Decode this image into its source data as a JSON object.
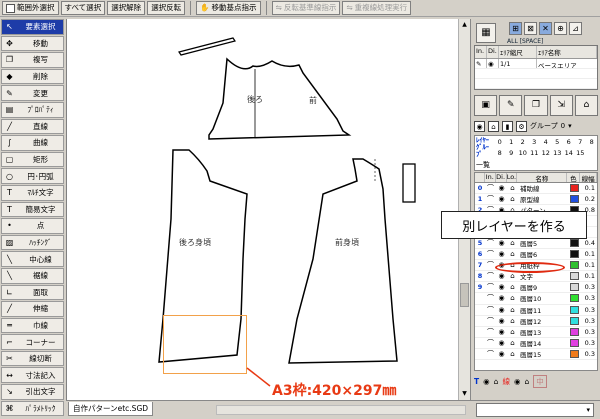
{
  "toolbar": {
    "buttons": [
      {
        "label": "範囲外選択",
        "checkbox": true
      },
      {
        "label": "すべて選択"
      },
      {
        "label": "選択解除"
      },
      {
        "label": "選択反転"
      },
      {
        "label": "移動基点指示"
      },
      {
        "label": "反転基準線指示",
        "disabled": true
      },
      {
        "label": "重複線処理実行",
        "disabled": true
      }
    ]
  },
  "left_tools": [
    {
      "icon": "↖",
      "label": "要素選択",
      "selected": true
    },
    {
      "icon": "✥",
      "label": "移動"
    },
    {
      "icon": "❐",
      "label": "複写"
    },
    {
      "icon": "◆",
      "label": "削除"
    },
    {
      "icon": "✎",
      "label": "変更"
    },
    {
      "icon": "▤",
      "label": "ﾌﾟﾛﾊﾟﾃｨ"
    },
    {
      "icon": "╱",
      "label": "直線"
    },
    {
      "icon": "∫",
      "label": "曲線"
    },
    {
      "icon": "▢",
      "label": "矩形"
    },
    {
      "icon": "○",
      "label": "円･円弧"
    },
    {
      "icon": "T",
      "label": "ﾏﾙﾁ文字"
    },
    {
      "icon": "T",
      "label": "簡易文字"
    },
    {
      "icon": "•",
      "label": "点"
    },
    {
      "icon": "▨",
      "label": "ﾊｯﾁﾝｸﾞ"
    },
    {
      "icon": "╲",
      "label": "中心線"
    },
    {
      "icon": "╲",
      "label": "裾線"
    },
    {
      "icon": "∟",
      "label": "面取"
    },
    {
      "icon": "╱",
      "label": "伸縮"
    },
    {
      "icon": "═",
      "label": "巾線"
    },
    {
      "icon": "⌐",
      "label": "コーナー"
    },
    {
      "icon": "✂",
      "label": "線切断"
    },
    {
      "icon": "↔",
      "label": "寸法記入"
    },
    {
      "icon": "↘",
      "label": "引出文字"
    },
    {
      "icon": "⌘",
      "label": "ﾊﾟﾗﾒﾄﾘｯｸ"
    }
  ],
  "canvas": {
    "labels": {
      "back": "後ろ",
      "front": "前",
      "back_body": "後ろ身頃",
      "front_body": "前身頃"
    }
  },
  "tab": {
    "file": "自作パターンetc.SGD"
  },
  "right_panel": {
    "allspace": "ALL [SPACE]",
    "area_headers": [
      "In.",
      "Di.",
      "ｴﾘｱ縮尺",
      "ｴﾘｱ名称"
    ],
    "area_row": {
      "scale": "1/1",
      "name": "ベースエリア"
    },
    "group_label": "グループ",
    "group_value": "0",
    "layer_group_label": "ﾚｲﾔｰ ｸﾞﾙｰﾌﾟ",
    "group_nums_top": [
      "0",
      "1",
      "2",
      "3",
      "4",
      "5",
      "6",
      "7",
      "8"
    ],
    "group_nums_bottom": [
      "8",
      "9",
      "10",
      "11",
      "12",
      "13",
      "14",
      "15"
    ],
    "ichiran": "一覧",
    "layer_headers": [
      "",
      "In.",
      "Di.",
      "Lo.",
      "名称",
      "色",
      "線幅"
    ],
    "layers": [
      {
        "no": "0",
        "name": "補助線",
        "color": "#e8231e",
        "width": "0.1"
      },
      {
        "no": "1",
        "name": "原型線",
        "color": "#2050e0",
        "width": "0.2"
      },
      {
        "no": "2",
        "name": "パターン",
        "color": "#111111",
        "width": "0.8"
      },
      {
        "no": "3",
        "name": "",
        "color": "#111111",
        "width": ""
      },
      {
        "no": "4",
        "name": "",
        "color": "#ffffff",
        "width": ""
      },
      {
        "no": "5",
        "name": "画層5",
        "color": "#111111",
        "width": "0.4"
      },
      {
        "no": "6",
        "name": "画層6",
        "color": "#111111",
        "width": "0.1"
      },
      {
        "no": "7",
        "name": "用紙枠",
        "color": "#30c030",
        "width": "0.1"
      },
      {
        "no": "8",
        "name": "文字",
        "color": "#d8d8d8",
        "width": "0.1"
      },
      {
        "no": "9",
        "name": "画層9",
        "color": "#d8d8d8",
        "width": "0.3"
      },
      {
        "no": "",
        "name": "画層10",
        "color": "#30e030",
        "width": "0.3"
      },
      {
        "no": "",
        "name": "画層11",
        "color": "#30e0e0",
        "width": "0.3"
      },
      {
        "no": "",
        "name": "画層12",
        "color": "#30e0e0",
        "width": "0.3"
      },
      {
        "no": "",
        "name": "画層13",
        "color": "#e040e0",
        "width": "0.3"
      },
      {
        "no": "",
        "name": "画層14",
        "color": "#e040e0",
        "width": "0.3"
      },
      {
        "no": "",
        "name": "画層15",
        "color": "#f07a1a",
        "width": "0.3"
      }
    ],
    "bottom_labels": {
      "t": "T",
      "line": "線",
      "hatch_off": "中"
    }
  },
  "annotations": {
    "callout": "別レイヤーを作る",
    "a3": "A3枠:420×297㎜"
  }
}
